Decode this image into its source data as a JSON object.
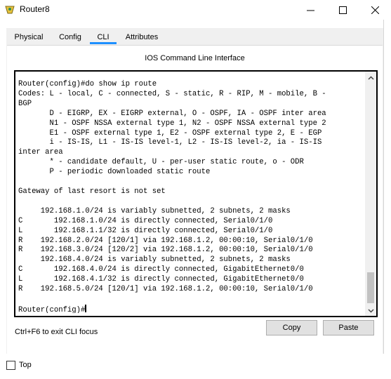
{
  "window": {
    "title": "Router8",
    "minimize_glyph": "—",
    "maximize_glyph": "☐",
    "close_glyph": "✕"
  },
  "tabs": [
    {
      "label": "Physical"
    },
    {
      "label": "Config"
    },
    {
      "label": "CLI"
    },
    {
      "label": "Attributes"
    }
  ],
  "active_tab": "CLI",
  "cli": {
    "heading": "IOS Command Line Interface",
    "lines": [
      "Router(config)#do show ip route",
      "Codes: L - local, C - connected, S - static, R - RIP, M - mobile, B -",
      "BGP",
      "       D - EIGRP, EX - EIGRP external, O - OSPF, IA - OSPF inter area",
      "       N1 - OSPF NSSA external type 1, N2 - OSPF NSSA external type 2",
      "       E1 - OSPF external type 1, E2 - OSPF external type 2, E - EGP",
      "       i - IS-IS, L1 - IS-IS level-1, L2 - IS-IS level-2, ia - IS-IS",
      "inter area",
      "       * - candidate default, U - per-user static route, o - ODR",
      "       P - periodic downloaded static route",
      "",
      "Gateway of last resort is not set",
      "",
      "     192.168.1.0/24 is variably subnetted, 2 subnets, 2 masks",
      "C       192.168.1.0/24 is directly connected, Serial0/1/0",
      "L       192.168.1.1/32 is directly connected, Serial0/1/0",
      "R    192.168.2.0/24 [120/1] via 192.168.1.2, 00:00:10, Serial0/1/0",
      "R    192.168.3.0/24 [120/2] via 192.168.1.2, 00:00:10, Serial0/1/0",
      "     192.168.4.0/24 is variably subnetted, 2 subnets, 2 masks",
      "C       192.168.4.0/24 is directly connected, GigabitEthernet0/0",
      "L       192.168.4.1/32 is directly connected, GigabitEthernet0/0",
      "R    192.168.5.0/24 [120/1] via 192.168.1.2, 00:00:10, Serial0/1/0",
      "",
      "Router(config)#"
    ]
  },
  "hint": "Ctrl+F6 to exit CLI focus",
  "buttons": {
    "copy": "Copy",
    "paste": "Paste"
  },
  "footer": {
    "top_label": "Top",
    "top_checked": false
  },
  "colors": {
    "accent": "#1e90ff"
  }
}
